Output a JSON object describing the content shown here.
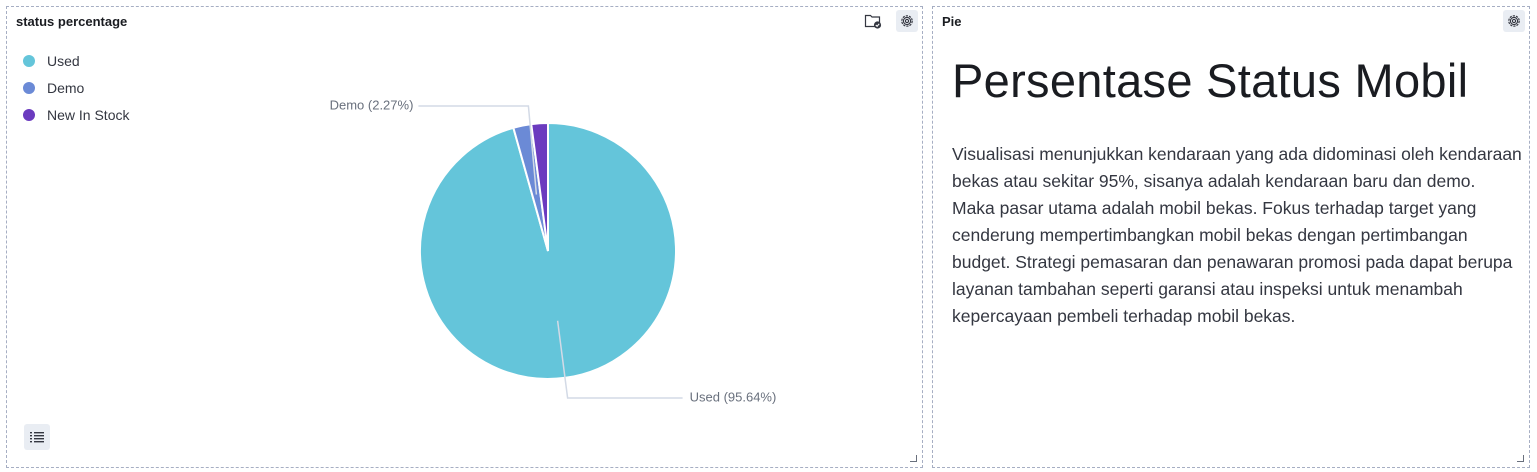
{
  "left_panel": {
    "title": "status percentage"
  },
  "right_panel": {
    "title": "Pie",
    "heading": "Persentase Status Mobil",
    "body": "Visualisasi menunjukkan kendaraan yang ada didominasi oleh kendaraan bekas atau sekitar 95%, sisanya adalah kendaraan baru dan demo. Maka pasar utama adalah mobil bekas. Fokus terhadap target yang cenderung mempertimbangkan mobil bekas dengan pertimbangan budget. Strategi pemasaran dan penawaran promosi pada dapat berupa layanan tambahan seperti garansi atau inspeksi untuk menambah kepercayaan pembeli terhadap mobil bekas."
  },
  "chart_data": {
    "type": "pie",
    "legend_position": "top-left",
    "slices": [
      {
        "label": "Used",
        "value": 95.64,
        "color": "#64c5da"
      },
      {
        "label": "Demo",
        "value": 2.27,
        "color": "#6b8ad6"
      },
      {
        "label": "New In Stock",
        "value": 2.09,
        "color": "#6b3bbf"
      }
    ],
    "data_labels": [
      {
        "text": "Used (95.64%)",
        "slice": "Used"
      },
      {
        "text": "Demo (2.27%)",
        "slice": "Demo"
      }
    ]
  },
  "colors": {
    "border": "#a6aec3",
    "leader_line": "#d3dae6",
    "label_text": "#69707d"
  },
  "icons": [
    "folder-check-icon",
    "gear-icon",
    "list-icon",
    "resize-handle-icon"
  ]
}
